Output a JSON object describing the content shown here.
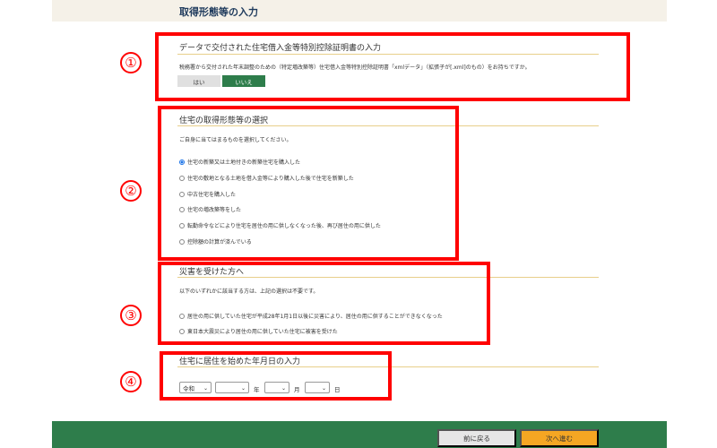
{
  "header": {
    "title": "取得形態等の入力"
  },
  "section1": {
    "title": "データで交付された住宅借入金等特別控除証明書の入力",
    "description": "税務署から交付された年末調整のための（特定増改築等）住宅借入金等特別控除証明書「xmlデータ」（拡張子が[.xml]のもの）をお持ちですか。",
    "yes_label": "はい",
    "no_label": "いいえ"
  },
  "section2": {
    "title": "住宅の取得形態等の選択",
    "description": "ご自身に当てはまるものを選択してください。",
    "options": [
      "住宅の新築又は土地付きの新築住宅を購入した",
      "住宅の敷地となる土地を借入金等により購入した後で住宅を新築した",
      "中古住宅を購入した",
      "住宅の増改築等をした",
      "転勤命令などにより住宅を居住の用に供しなくなった後、再び居住の用に供した",
      "控除額の計算が済んでいる"
    ]
  },
  "section3": {
    "title": "災害を受けた方へ",
    "description": "以下のいずれかに該当する方は、上記の選択は不要です。",
    "options": [
      "居住の用に供していた住宅が平成28年1月1日以後に災害により、居住の用に供することができなくなった",
      "東日本大震災により居住の用に供していた住宅に被害を受けた"
    ]
  },
  "section4": {
    "title": "住宅に居住を始めた年月日の入力",
    "era_value": "令和",
    "year_unit": "年",
    "month_unit": "月",
    "day_unit": "日"
  },
  "markers": [
    "①",
    "②",
    "③",
    "④"
  ],
  "footer": {
    "back_label": "前に戻る",
    "next_label": "次へ進む"
  }
}
